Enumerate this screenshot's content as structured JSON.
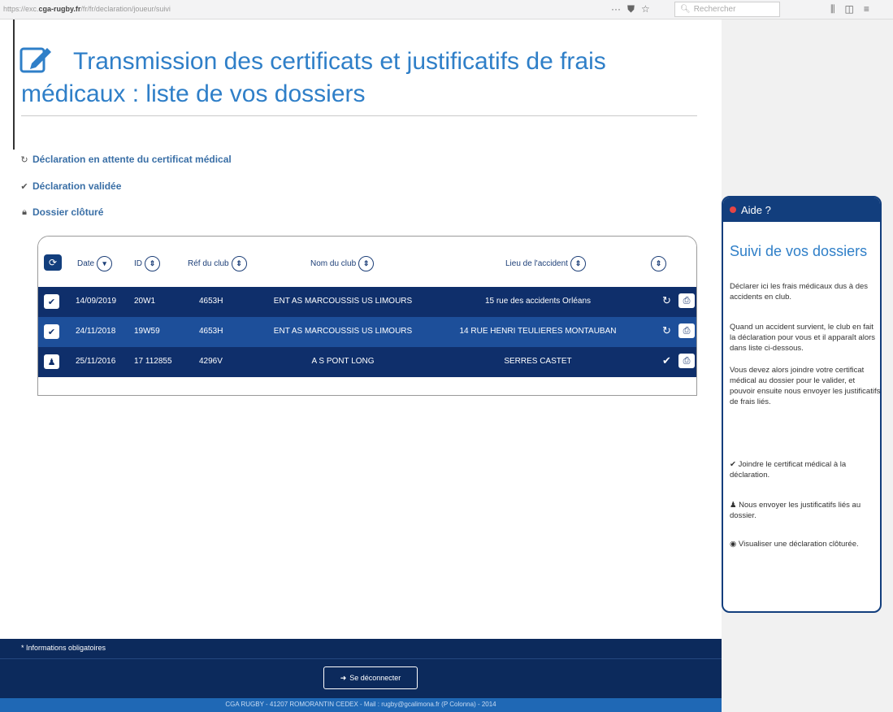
{
  "browser": {
    "url_prefix": "https://exc.",
    "url_domain": "cga-rugby.fr",
    "url_path": "/fr/fr/declaration/joueur/suivi",
    "search_placeholder": "Rechercher"
  },
  "page": {
    "title": "Transmission des certificats et justificatifs de frais médicaux : liste de vos dossiers"
  },
  "legend": [
    {
      "icon": "clock-icon",
      "label": "Déclaration en attente du certificat médical"
    },
    {
      "icon": "check-icon",
      "label": "Déclaration validée"
    },
    {
      "icon": "lock-icon",
      "label": "Dossier clôturé"
    }
  ],
  "table": {
    "columns": [
      "Date",
      "ID",
      "Réf du club",
      "Nom du club",
      "Lieu de l'accident"
    ],
    "rows": [
      {
        "action_icon": "check-icon",
        "date": "14/09/2019",
        "id": "20W1",
        "ref": "4653H",
        "club": "ENT AS MARCOUSSIS US LIMOURS",
        "lieu": "15 rue des accidents Orléans",
        "status_icon": "clock-icon",
        "status": "↻"
      },
      {
        "action_icon": "check-icon",
        "date": "24/11/2018",
        "id": "19W59",
        "ref": "4653H",
        "club": "ENT AS MARCOUSSIS US LIMOURS",
        "lieu": "14 RUE HENRI TEULIERES MONTAUBAN",
        "status_icon": "clock-icon",
        "status": "↻"
      },
      {
        "action_icon": "user-icon",
        "date": "25/11/2016",
        "id": "17 112855",
        "ref": "4296V",
        "club": "A S PONT LONG",
        "lieu": "SERRES CASTET",
        "status_icon": "check-icon",
        "status": "✔"
      }
    ]
  },
  "footer": {
    "note": "* Informations obligatoires",
    "logout_label": "Se déconnecter",
    "copyright": "CGA RUGBY - 41207 ROMORANTIN CEDEX - Mail : rugby@gcalimona.fr (P Colonna) - 2014"
  },
  "help": {
    "header": "Aide ?",
    "title": "Suivi de vos dossiers",
    "paragraphs": [
      "Déclarer ici les frais médicaux dus à des accidents en club.",
      "Quand un accident survient, le club en fait la déclaration pour vous et il apparaît alors dans liste ci-dessous.",
      "Vous devez alors joindre votre certificat médical au dossier pour le valider, et pouvoir ensuite nous envoyer les justificatifs de frais liés.",
      "✔  Joindre le certificat médical à la déclaration.",
      "♟  Nous envoyer les justificatifs liés au dossier.",
      "◉  Visualiser une déclaration clôturée."
    ]
  },
  "colors": {
    "accent": "#2f7fc8",
    "navy": "#0c2a5c",
    "row_dark": "#0f2f6b",
    "row_blue": "#1d4f9a"
  }
}
